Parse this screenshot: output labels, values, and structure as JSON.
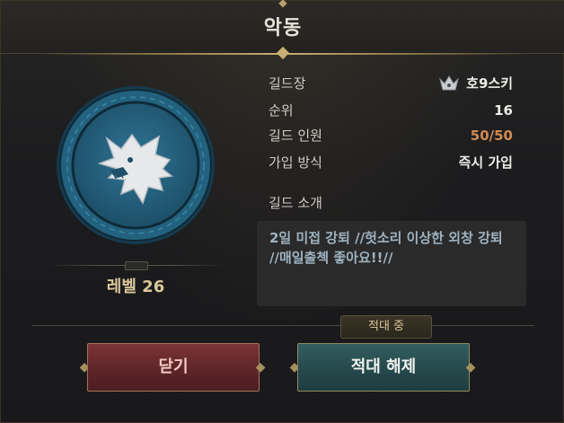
{
  "dialog": {
    "title": "악동"
  },
  "guild": {
    "level_label": "레벨 26",
    "emblem_icon": "wolf-emblem-icon",
    "rows": [
      {
        "label": "길드장",
        "value": "호9스키",
        "icon": "guild-leader-crown-icon"
      },
      {
        "label": "순위",
        "value": "16"
      },
      {
        "label": "길드 인원",
        "value": "50/50"
      },
      {
        "label": "가입 방식",
        "value": "즉시 가입"
      }
    ],
    "intro_title": "길드 소개",
    "intro_lines": [
      "2일 미접 강퇴 //헛소리 이상한 외창 강퇴",
      "//매일출첵 좋아요!!//"
    ]
  },
  "status_tab": "적대 중",
  "buttons": {
    "close": "닫기",
    "release_hostility": "적대 해제"
  },
  "colors": {
    "member_count": "#d08a52",
    "close_button": "#5e2528",
    "release_button": "#26494c",
    "emblem": "#2a6e8e"
  }
}
